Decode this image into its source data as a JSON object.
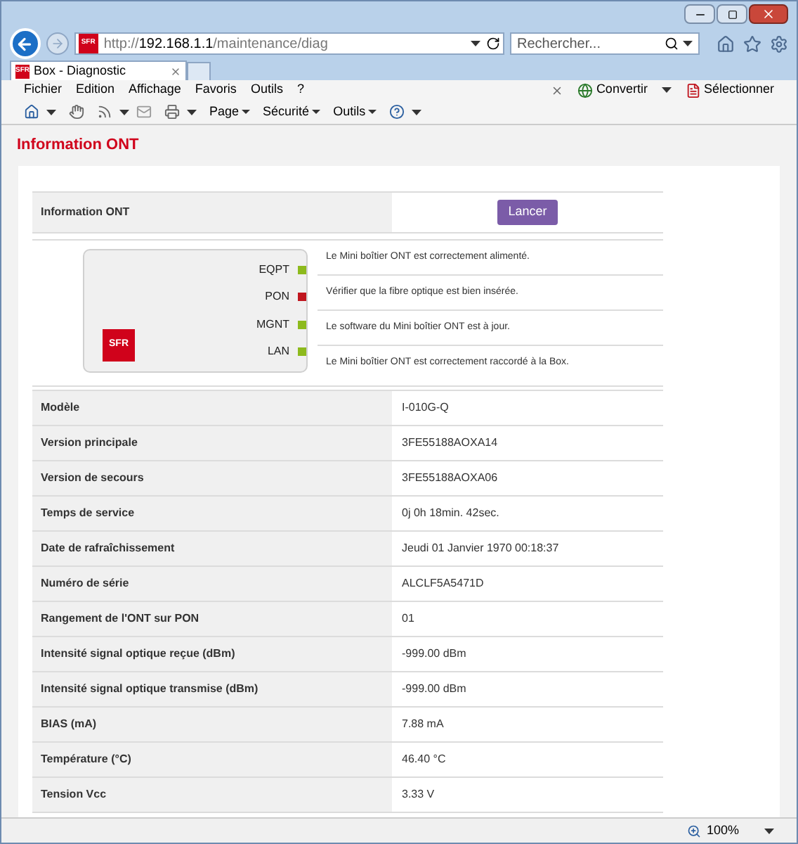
{
  "browser": {
    "url_scheme": "http://",
    "url_host": "192.168.1.1",
    "url_path": "/maintenance/diag",
    "search_placeholder": "Rechercher...",
    "address_favicon": "SFR",
    "tab_favicon": "SFR",
    "tab_title": "Box - Diagnostic",
    "menus": [
      "Fichier",
      "Edition",
      "Affichage",
      "Favoris",
      "Outils",
      "?"
    ],
    "command_menus": [
      "Page",
      "Sécurité",
      "Outils"
    ],
    "addon_buttons": [
      "Convertir",
      "Sélectionner"
    ],
    "zoom": "100%"
  },
  "page": {
    "title": "Information ONT",
    "launch_label": "Information ONT",
    "launch_button": "Lancer",
    "logo": "SFR",
    "leds": [
      {
        "name": "EQPT",
        "color": "#8dba1d",
        "message": "Le Mini boîtier ONT est correctement alimenté."
      },
      {
        "name": "PON",
        "color": "#c0161f",
        "message": "Vérifier que la fibre optique est bien insérée."
      },
      {
        "name": "MGNT",
        "color": "#8dba1d",
        "message": "Le software du Mini boîtier ONT est à jour."
      },
      {
        "name": "LAN",
        "color": "#8dba1d",
        "message": "Le Mini boîtier ONT est correctement raccordé à la Box."
      }
    ],
    "rows": [
      {
        "label": "Modèle",
        "value": "I-010G-Q"
      },
      {
        "label": "Version principale",
        "value": "3FE55188AOXA14"
      },
      {
        "label": "Version de secours",
        "value": "3FE55188AOXA06"
      },
      {
        "label": "Temps de service",
        "value": "0j 0h 18min. 42sec."
      },
      {
        "label": "Date de rafraîchissement",
        "value": "Jeudi 01 Janvier 1970 00:18:37"
      },
      {
        "label": "Numéro de série",
        "value": "ALCLF5A5471D"
      },
      {
        "label": "Rangement de l'ONT sur PON",
        "value": "01"
      },
      {
        "label": "Intensité signal optique reçue (dBm)",
        "value": "-999.00 dBm"
      },
      {
        "label": "Intensité signal optique transmise (dBm)",
        "value": "-999.00 dBm"
      },
      {
        "label": "BIAS (mA)",
        "value": "7.88 mA"
      },
      {
        "label": "Température (°C)",
        "value": "46.40 °C"
      },
      {
        "label": "Tension Vcc",
        "value": "3.33 V"
      }
    ]
  }
}
